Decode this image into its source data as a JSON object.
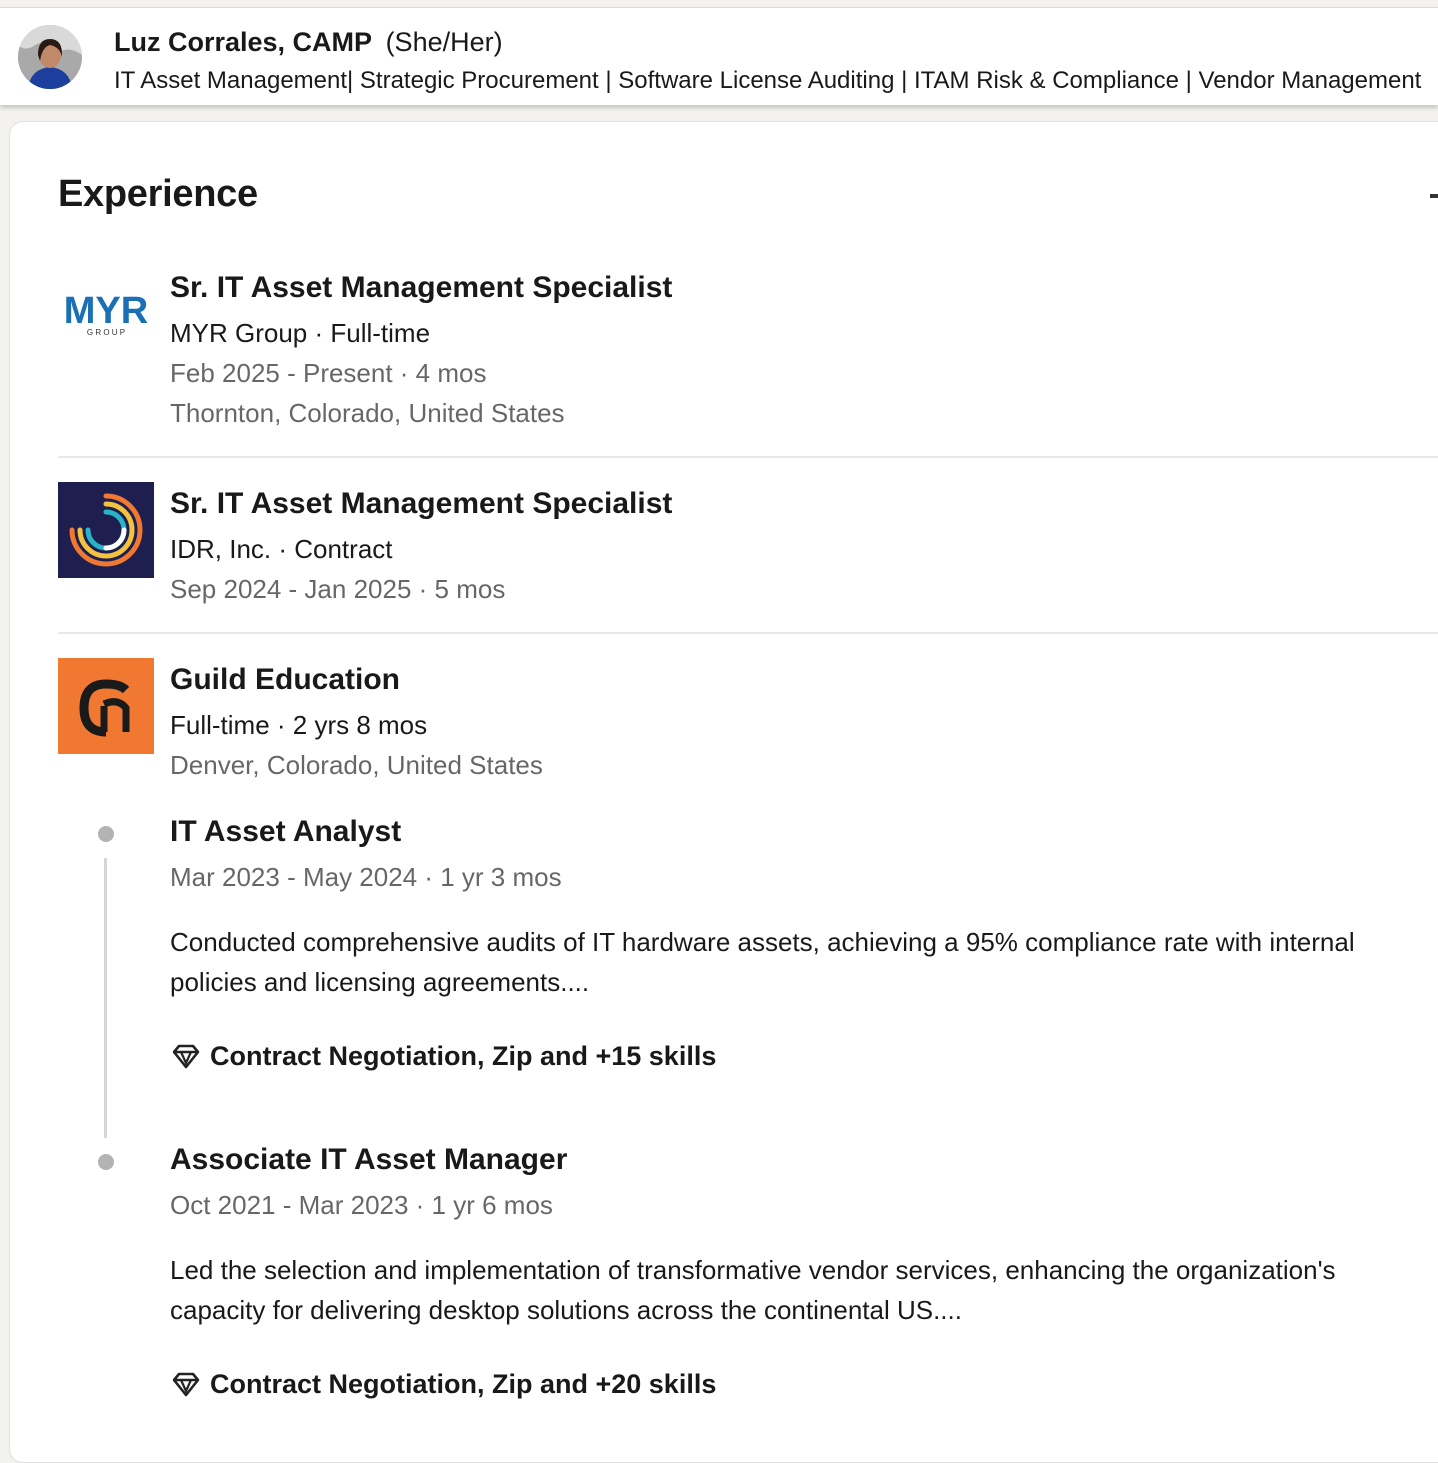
{
  "header": {
    "name": "Luz Corrales, CAMP",
    "pronouns": "(She/Her)",
    "headline": "IT Asset Management| Strategic Procurement | Software License Auditing | ITAM Risk & Compliance | Vendor Management"
  },
  "section": {
    "title": "Experience"
  },
  "experiences": [
    {
      "logo": "myr-group-logo",
      "logo_text": "MYR",
      "logo_subtext": "G R O U P",
      "title": "Sr. IT Asset Management Specialist",
      "company_line": "MYR Group · Full-time",
      "dates": "Feb 2025 - Present · 4 mos",
      "location": "Thornton, Colorado, United States"
    },
    {
      "logo": "idr-inc-logo",
      "title": "Sr. IT Asset Management Specialist",
      "company_line": "IDR, Inc. · Contract",
      "dates": "Sep 2024 - Jan 2025 · 5 mos"
    },
    {
      "logo": "guild-education-logo",
      "company": "Guild Education",
      "summary": "Full-time · 2 yrs 8 mos",
      "location": "Denver, Colorado, United States",
      "roles": [
        {
          "title": "IT Asset Analyst",
          "dates": "Mar 2023 - May 2024 · 1 yr 3 mos",
          "description": "Conducted comprehensive audits of IT hardware assets, achieving a 95% compliance rate with internal policies and licensing agreements....",
          "skills": "Contract Negotiation, Zip and +15 skills"
        },
        {
          "title": "Associate IT Asset Manager",
          "dates": "Oct 2021 - Mar 2023 · 1 yr 6 mos",
          "description": "Led the selection and implementation of transformative vendor services, enhancing the organization's capacity for delivering desktop solutions across the continental US....",
          "skills": "Contract Negotiation, Zip and +20 skills"
        }
      ]
    }
  ],
  "colors": {
    "myr_blue": "#1a6fb5",
    "idr_navy": "#1f1f4f",
    "guild_orange": "#f07830",
    "muted_text": "#666666",
    "divider": "#e8e8e8"
  }
}
